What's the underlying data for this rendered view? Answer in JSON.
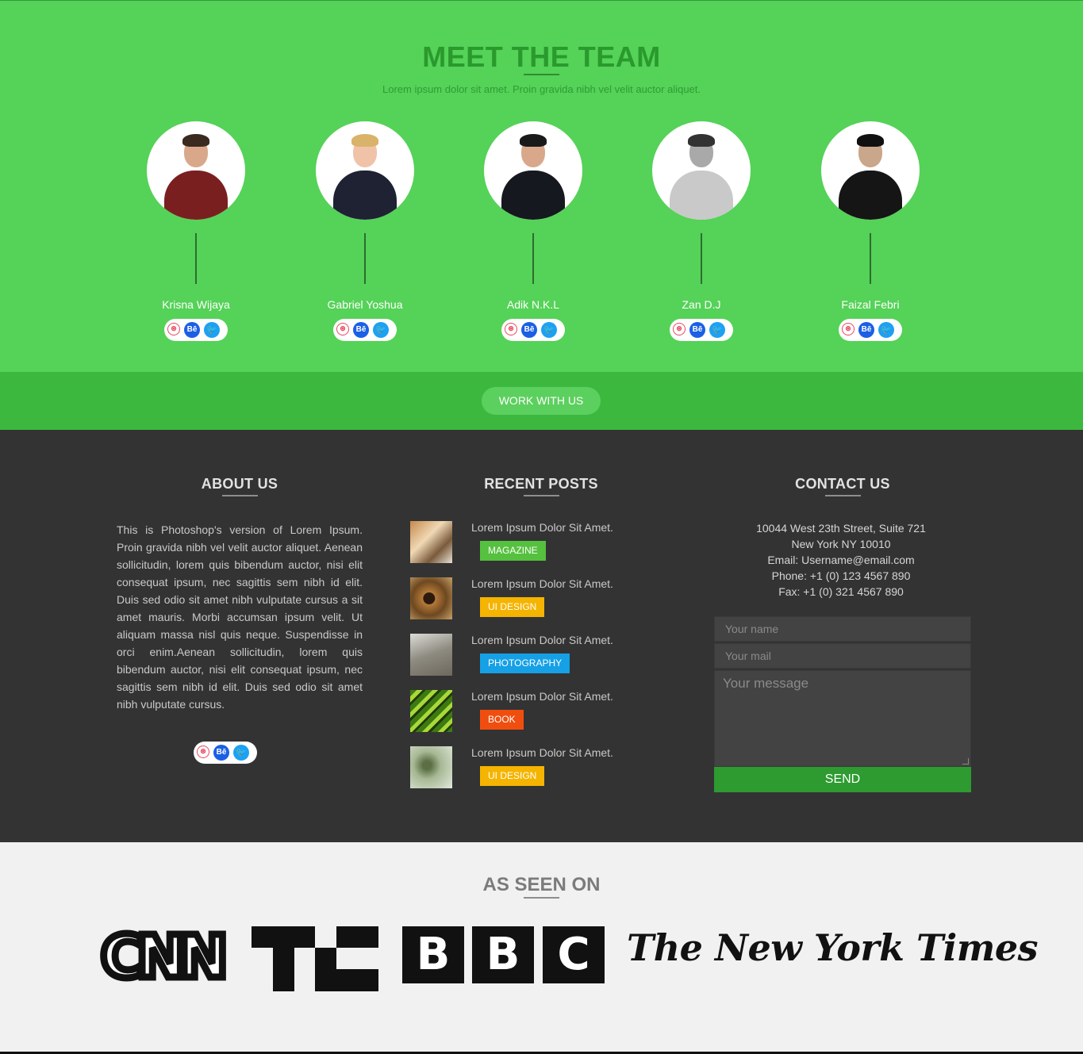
{
  "team": {
    "title": "MEET THE TEAM",
    "subtitle": "Lorem ipsum dolor sit amet. Proin gravida nibh vel velit auctor aliquet.",
    "members": [
      {
        "name": "Krisna Wijaya"
      },
      {
        "name": "Gabriel Yoshua"
      },
      {
        "name": "Adik N.K.L"
      },
      {
        "name": "Zan D.J"
      },
      {
        "name": "Faizal Febri"
      }
    ],
    "social_icons": [
      "dribbble-icon",
      "behance-icon",
      "twitter-icon"
    ],
    "social_glyphs": {
      "dribbble": "⊛",
      "behance": "Bē",
      "twitter": "🐦"
    },
    "cta_label": "WORK WITH US"
  },
  "about": {
    "title": "ABOUT US",
    "text": "This is Photoshop's version of Lorem Ipsum. Proin gravida nibh vel velit auctor aliquet. Aenean sollicitudin, lorem quis bibendum auctor, nisi elit consequat ipsum, nec sagittis sem nibh id elit. Duis sed odio sit amet nibh vulputate cursus a sit amet mauris. Morbi accumsan ipsum velit. Ut aliquam massa nisl quis neque. Suspendisse in orci enim.Aenean sollicitudin, lorem quis bibendum auctor, nisi elit consequat ipsum, nec sagittis sem nibh id elit. Duis sed odio sit amet nibh vulputate cursus."
  },
  "recent_posts": {
    "title": "RECENT POSTS",
    "items": [
      {
        "title": "Lorem Ipsum Dolor Sit Amet.",
        "tag": "MAGAZINE",
        "tag_color": "#55c13f"
      },
      {
        "title": "Lorem Ipsum Dolor Sit Amet.",
        "tag": "UI DESIGN",
        "tag_color": "#f5b400"
      },
      {
        "title": "Lorem Ipsum Dolor Sit Amet.",
        "tag": "PHOTOGRAPHY",
        "tag_color": "#16a0e6"
      },
      {
        "title": "Lorem Ipsum Dolor Sit Amet.",
        "tag": "BOOK",
        "tag_color": "#f04e0f"
      },
      {
        "title": "Lorem Ipsum Dolor Sit Amet.",
        "tag": "UI DESIGN",
        "tag_color": "#f5b400"
      }
    ]
  },
  "contact": {
    "title": "CONTACT US",
    "address_line1": "10044 West 23th Street, Suite 721",
    "address_line2": "New York NY 10010",
    "email": "Email: Username@email.com",
    "phone": "Phone: +1 (0) 123 4567 890",
    "fax": "Fax: +1 (0) 321 4567 890",
    "name_placeholder": "Your name",
    "mail_placeholder": "Your mail",
    "message_placeholder": "Your message",
    "send_label": "SEND"
  },
  "seen_on": {
    "title": "AS SEEN ON",
    "logos": {
      "cnn": "CNN",
      "techcrunch": "TC",
      "bbc": [
        "B",
        "B",
        "C"
      ],
      "nyt": "The New York Times"
    }
  },
  "colors": {
    "team_bg": "#55d258",
    "cta_bar": "#3cb83f",
    "footer_bg": "#333333",
    "send_button": "#2d9b30",
    "seen_bg": "#f1f1f1"
  }
}
